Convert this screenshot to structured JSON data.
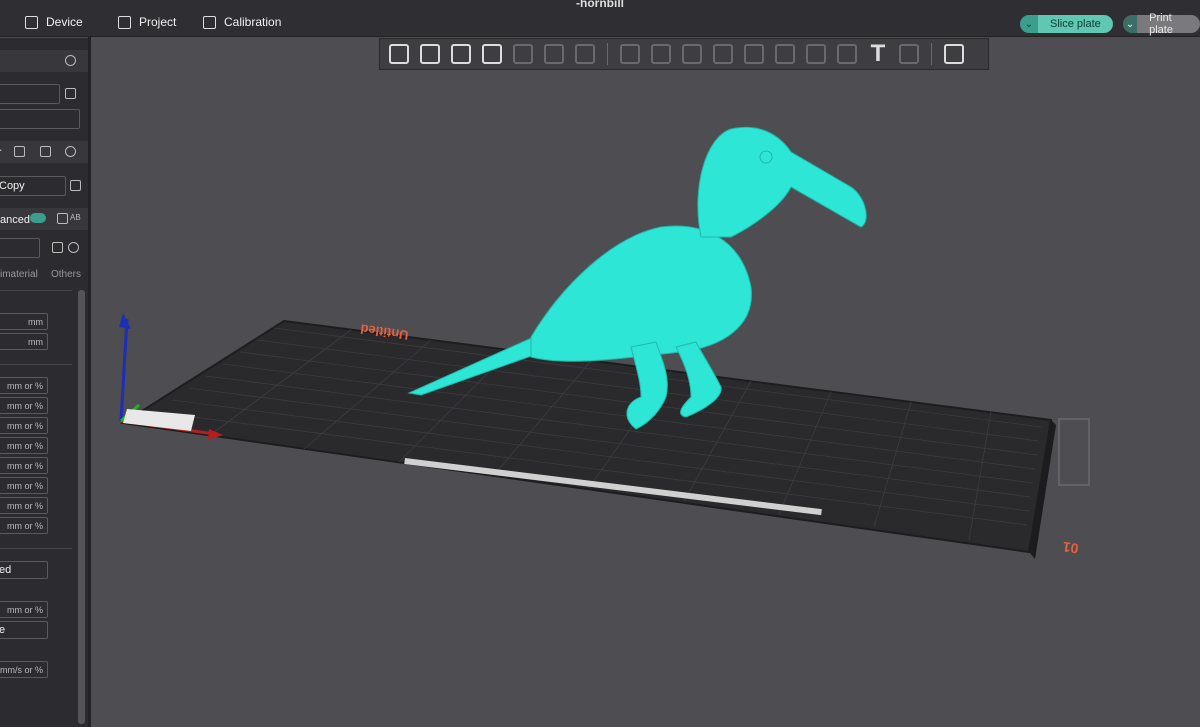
{
  "app": {
    "document_title": "-hornbill"
  },
  "topbar": {
    "tabs": [
      {
        "label": "Device",
        "icon": "device-icon"
      },
      {
        "label": "Project",
        "icon": "project-icon"
      },
      {
        "label": "Calibration",
        "icon": "calibration-icon"
      }
    ],
    "slice_plate": "Slice plate",
    "print_plate": "Print plate",
    "accent": "#5fc7b2"
  },
  "sidebar": {
    "filament_preset": "Copy",
    "advanced_label": "anced",
    "tabs_partial": [
      "imaterial",
      "Others"
    ],
    "units": {
      "mm": "mm",
      "mm_or_pct": "mm or %",
      "mms_or_pct": "mm/s or %"
    },
    "value_ed": "ed",
    "value_e": "e"
  },
  "viewport": {
    "plate_label": "Untitled",
    "plate_number": "01",
    "model_color": "#2ee6d6",
    "model_name": "hornbill"
  }
}
